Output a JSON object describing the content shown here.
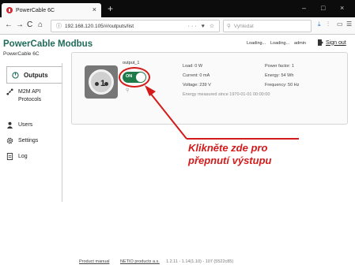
{
  "browser": {
    "tab_title": "PowerCable 6C",
    "tab_close": "×",
    "new_tab": "+",
    "window_controls": [
      "–",
      "□",
      "×"
    ],
    "nav": {
      "back": "←",
      "forward": "→",
      "reload": "C",
      "home": "⌂"
    },
    "url": "192.168.120.105/#/outputs/list",
    "url_tools": "··· ♥ ☆",
    "search_placeholder": "Vyhledat",
    "right_tools": [
      "⤓",
      "⫶",
      "▭",
      "☰"
    ]
  },
  "app": {
    "brand": "PowerCable Modbus",
    "model": "PowerCable 6C",
    "header_status_1": "Loading...",
    "header_status_2": "Loading...",
    "user": "admin",
    "sign_out": "Sign out"
  },
  "sidebar": {
    "items": [
      {
        "label": "Outputs",
        "icon": "power-icon"
      },
      {
        "label": "M2M API Protocols",
        "icon": "nodes-icon"
      },
      {
        "label": "Users",
        "icon": "users-icon"
      },
      {
        "label": "Settings",
        "icon": "gear-icon"
      },
      {
        "label": "Log",
        "icon": "document-icon"
      }
    ]
  },
  "output": {
    "socket_number": "1",
    "name": "output_1",
    "toggle_label": "ON",
    "state_on": true,
    "schedule_icon": "⚲",
    "load": "Load: 0 W",
    "current": "Current: 0 mA",
    "voltage": "Voltage: 239 V",
    "energy_since": "Energy measured since 1970-01-01 00:00:00",
    "power_factor": "Power factor: 1",
    "energy": "Energy: 54 Wh",
    "frequency": "Frequency: 50 Hz"
  },
  "annotation": {
    "line1": "Klikněte zde pro",
    "line2": "přepnutí výstupu",
    "color": "#d41b1b"
  },
  "footer": {
    "manual": "Product manual",
    "company": "NETIO products a.s.",
    "version": "1.2.11 - 1.14(1.10) - 107 (5522c85)"
  },
  "colors": {
    "brand": "#1f6b5a",
    "toggle_on": "#1f7a4a"
  }
}
